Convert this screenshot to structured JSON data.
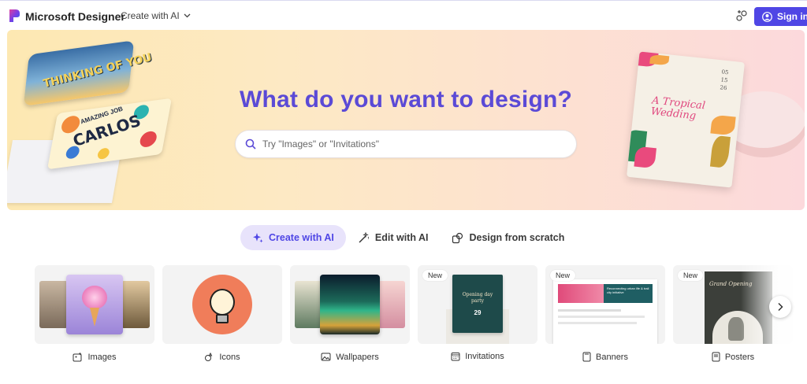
{
  "header": {
    "brand": "Microsoft Designer",
    "create_menu_label": "Create with AI",
    "signin_label": "Sign in",
    "accent": "#4f46e5"
  },
  "hero": {
    "title": "What do you want to design?",
    "search_placeholder": "Try \"Images\" or \"Invitations\"",
    "title_color": "#5b4ad6",
    "card_thinking_text": "THINKING OF YOU",
    "card_carlos_sub": "AMAZING JOB",
    "card_carlos_text": "CARLOS",
    "invite_title": "A Tropical Wedding",
    "invite_date": [
      "05",
      "15",
      "26"
    ]
  },
  "modes": [
    {
      "label": "Create with AI",
      "icon": "sparkle-icon",
      "active": true
    },
    {
      "label": "Edit with AI",
      "icon": "magic-wand-icon",
      "active": false
    },
    {
      "label": "Design from scratch",
      "icon": "shapes-icon",
      "active": false
    }
  ],
  "categories": [
    {
      "label": "Images",
      "icon": "image-sparkle-icon",
      "badge": ""
    },
    {
      "label": "Icons",
      "icon": "icon-sparkle-icon",
      "badge": ""
    },
    {
      "label": "Wallpapers",
      "icon": "wallpaper-icon",
      "badge": ""
    },
    {
      "label": "Invitations",
      "icon": "calendar-icon",
      "badge": "New"
    },
    {
      "label": "Banners",
      "icon": "banner-icon",
      "badge": "New"
    },
    {
      "label": "Posters",
      "icon": "poster-icon",
      "badge": "New"
    }
  ],
  "thumbs": {
    "invitation_title": "Opening day party",
    "invitation_date": "29",
    "banner_text": "Reconnecting urban life & trail city initiative",
    "poster_text": "Grand Opening"
  }
}
